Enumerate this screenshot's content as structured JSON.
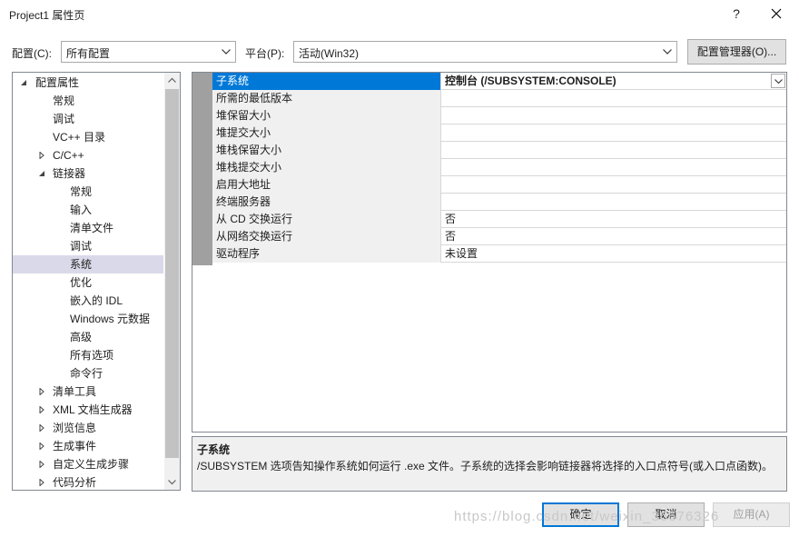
{
  "window": {
    "title": "Project1 属性页",
    "help": "?"
  },
  "config": {
    "label": "配置(C):",
    "value": "所有配置"
  },
  "platform": {
    "label": "平台(P):",
    "value": "活动(Win32)"
  },
  "config_manager_label": "配置管理器(O)...",
  "tree": [
    {
      "label": "配置属性",
      "level": 0,
      "expander": "expanded"
    },
    {
      "label": "常规",
      "level": 1,
      "expander": "none"
    },
    {
      "label": "调试",
      "level": 1,
      "expander": "none"
    },
    {
      "label": "VC++ 目录",
      "level": 1,
      "expander": "none"
    },
    {
      "label": "C/C++",
      "level": 1,
      "expander": "collapsed"
    },
    {
      "label": "链接器",
      "level": 1,
      "expander": "expanded"
    },
    {
      "label": "常规",
      "level": 2,
      "expander": "none"
    },
    {
      "label": "输入",
      "level": 2,
      "expander": "none"
    },
    {
      "label": "清单文件",
      "level": 2,
      "expander": "none"
    },
    {
      "label": "调试",
      "level": 2,
      "expander": "none"
    },
    {
      "label": "系统",
      "level": 2,
      "expander": "none",
      "selected": true
    },
    {
      "label": "优化",
      "level": 2,
      "expander": "none"
    },
    {
      "label": "嵌入的 IDL",
      "level": 2,
      "expander": "none"
    },
    {
      "label": "Windows 元数据",
      "level": 2,
      "expander": "none"
    },
    {
      "label": "高级",
      "level": 2,
      "expander": "none"
    },
    {
      "label": "所有选项",
      "level": 2,
      "expander": "none"
    },
    {
      "label": "命令行",
      "level": 2,
      "expander": "none"
    },
    {
      "label": "清单工具",
      "level": 1,
      "expander": "collapsed"
    },
    {
      "label": "XML 文档生成器",
      "level": 1,
      "expander": "collapsed"
    },
    {
      "label": "浏览信息",
      "level": 1,
      "expander": "collapsed"
    },
    {
      "label": "生成事件",
      "level": 1,
      "expander": "collapsed"
    },
    {
      "label": "自定义生成步骤",
      "level": 1,
      "expander": "collapsed"
    },
    {
      "label": "代码分析",
      "level": 1,
      "expander": "collapsed"
    }
  ],
  "properties": [
    {
      "name": "子系统",
      "value": "控制台 (/SUBSYSTEM:CONSOLE)",
      "selected": true
    },
    {
      "name": "所需的最低版本",
      "value": ""
    },
    {
      "name": "堆保留大小",
      "value": ""
    },
    {
      "name": "堆提交大小",
      "value": ""
    },
    {
      "name": "堆栈保留大小",
      "value": ""
    },
    {
      "name": "堆栈提交大小",
      "value": ""
    },
    {
      "name": "启用大地址",
      "value": ""
    },
    {
      "name": "终端服务器",
      "value": ""
    },
    {
      "name": "从 CD 交换运行",
      "value": "否"
    },
    {
      "name": "从网络交换运行",
      "value": "否"
    },
    {
      "name": "驱动程序",
      "value": "未设置"
    }
  ],
  "description": {
    "title": "子系统",
    "text": "/SUBSYSTEM 选项告知操作系统如何运行 .exe 文件。子系统的选择会影响链接器将选择的入口点符号(或入口点函数)。"
  },
  "buttons": {
    "ok": "确定",
    "cancel": "取消",
    "apply": "应用(A)"
  },
  "watermark": "https://blog.csdn.net/weixin_36676326",
  "colors": {
    "selection": "#0078d7",
    "gutter": "#a0a0a0",
    "tree_selection": "#d9d9e9"
  }
}
